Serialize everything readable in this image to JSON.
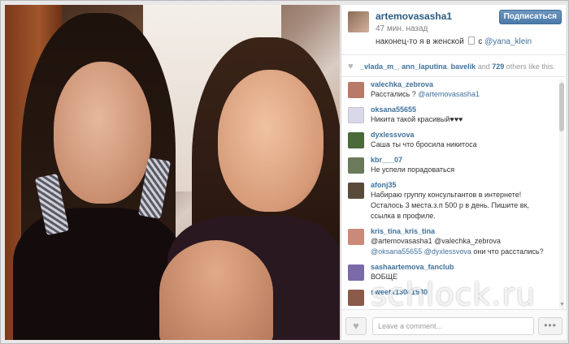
{
  "post": {
    "username": "artemovasasha1",
    "time": "47 мин. назад",
    "caption_text": "наконец-то я в женской",
    "caption_with": "с",
    "caption_mention": "@yana_klein",
    "follow_label": "Подписаться"
  },
  "likes": {
    "likers": [
      "_vlada_m_",
      "ann_laputina",
      "bavelik"
    ],
    "and": "and",
    "count": "729",
    "tail": "others like this."
  },
  "comments": [
    {
      "user": "valechka_zebrova",
      "text": "Расстались ?",
      "mention": "@artemovasasha1",
      "avatar_color": "#b87968"
    },
    {
      "user": "oksana55655",
      "text": "Никита такой красивый♥♥♥",
      "mention": "",
      "avatar_color": "#d8d8e8"
    },
    {
      "user": "dyxlessvova",
      "text": "Саша ты что бросила никитоса",
      "mention": "",
      "avatar_color": "#4a6a3a"
    },
    {
      "user": "kbr___07",
      "text": "Не успели порадоваться",
      "mention": "",
      "avatar_color": "#6a7a5a"
    },
    {
      "user": "afonj35",
      "text": "Набираю группу консультантов в интернете! Осталось 3 места.з.п 500 р в день. Пишите вк, ссылка в профиле.",
      "mention": "",
      "avatar_color": "#5a4a3a"
    },
    {
      "user": "kris_tina_kris_tina",
      "text_lines": [
        "@artemovasasha1 @valechka_zebrova",
        "@oksana55655 @dyxlessvova"
      ],
      "text": "они что расстались?",
      "avatar_color": "#c98a7a"
    },
    {
      "user": "sashaartemova_fanclub",
      "text": "ВОБЩЕ",
      "mention": "",
      "avatar_color": "#7a6aa8"
    },
    {
      "user": "sweetx13041980",
      "text": "",
      "mention": "",
      "avatar_color": "#8a5a4a"
    }
  ],
  "footer": {
    "comment_placeholder": "Leave a comment...",
    "like_icon": "heart-icon",
    "more_label": "•••"
  },
  "watermark": "schlock.ru",
  "colors": {
    "link": "#3f729b",
    "username": "#2b5b84",
    "follow_button": "#4c7aa8"
  }
}
